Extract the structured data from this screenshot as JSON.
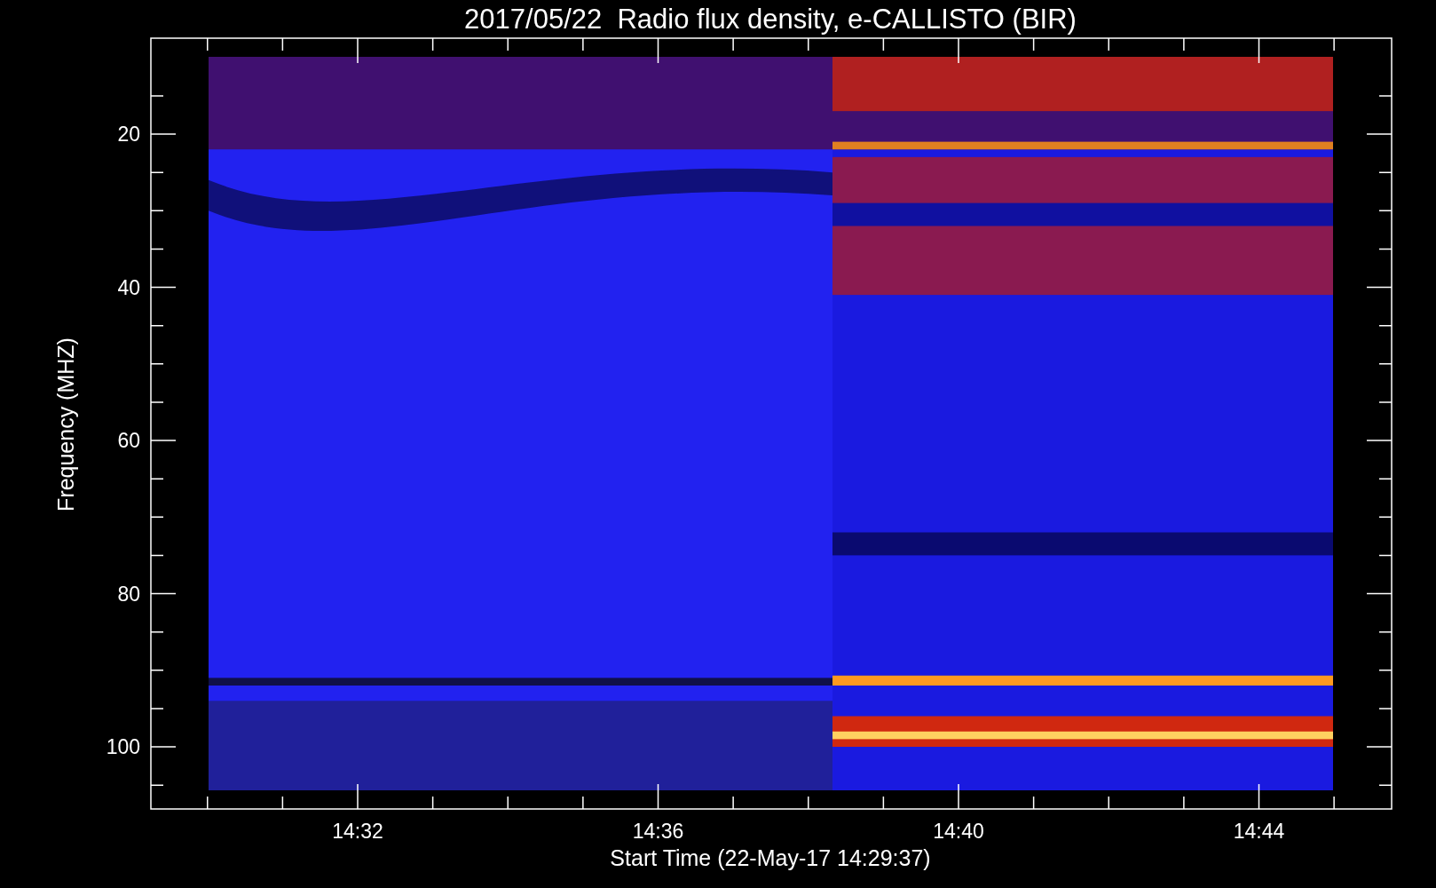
{
  "title": "2017/05/22  Radio flux density, e-CALLISTO (BIR)",
  "y_axis": {
    "label": "Frequency (MHZ)",
    "ticks": [
      "20",
      "40",
      "60",
      "80",
      "100"
    ]
  },
  "x_axis": {
    "label": "Start Time (22-May-17 14:29:37)",
    "ticks": [
      "14:32",
      "14:36",
      "14:40",
      "14:44"
    ]
  }
}
